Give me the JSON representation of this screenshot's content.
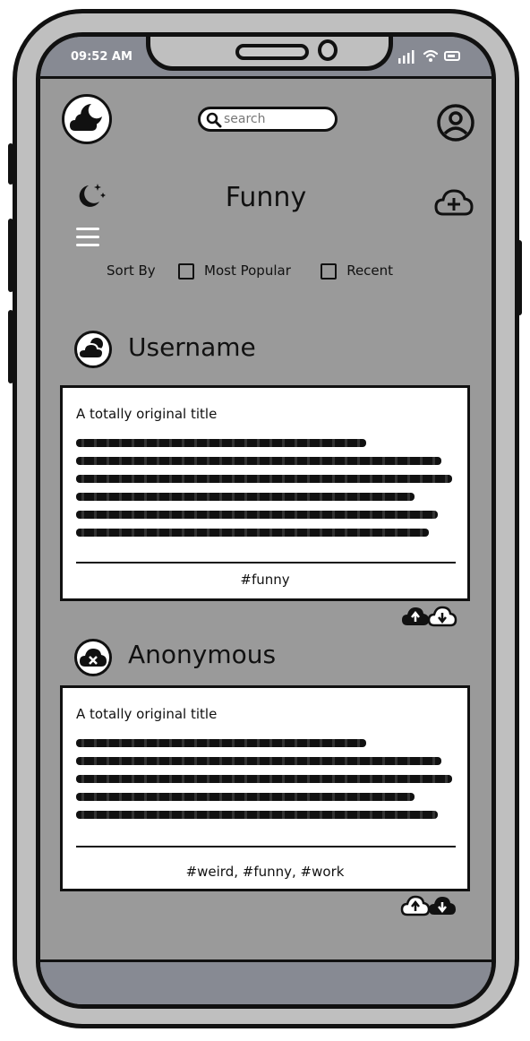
{
  "status_bar": {
    "time": "09:52 AM"
  },
  "search": {
    "placeholder": "search"
  },
  "page": {
    "title": "Funny"
  },
  "sort": {
    "label": "Sort By",
    "options": [
      "Most Popular",
      "Recent"
    ]
  },
  "posts": [
    {
      "username": "Username",
      "title": "A totally original title",
      "tags": "#funny"
    },
    {
      "username": "Anonymous",
      "title": "A totally original title",
      "tags": "#weird, #funny, #work"
    }
  ],
  "icons": {
    "logo": "cloud-moon-icon",
    "search": "search-icon",
    "profile": "user-circle-icon",
    "theme": "moon-stars-icon",
    "menu": "hamburger-menu-icon",
    "upload": "cloud-plus-icon",
    "user_avatar": "cloud-sun-icon",
    "anon_avatar": "cloud-x-icon",
    "upvote": "cloud-up-icon",
    "downvote": "cloud-down-icon"
  }
}
